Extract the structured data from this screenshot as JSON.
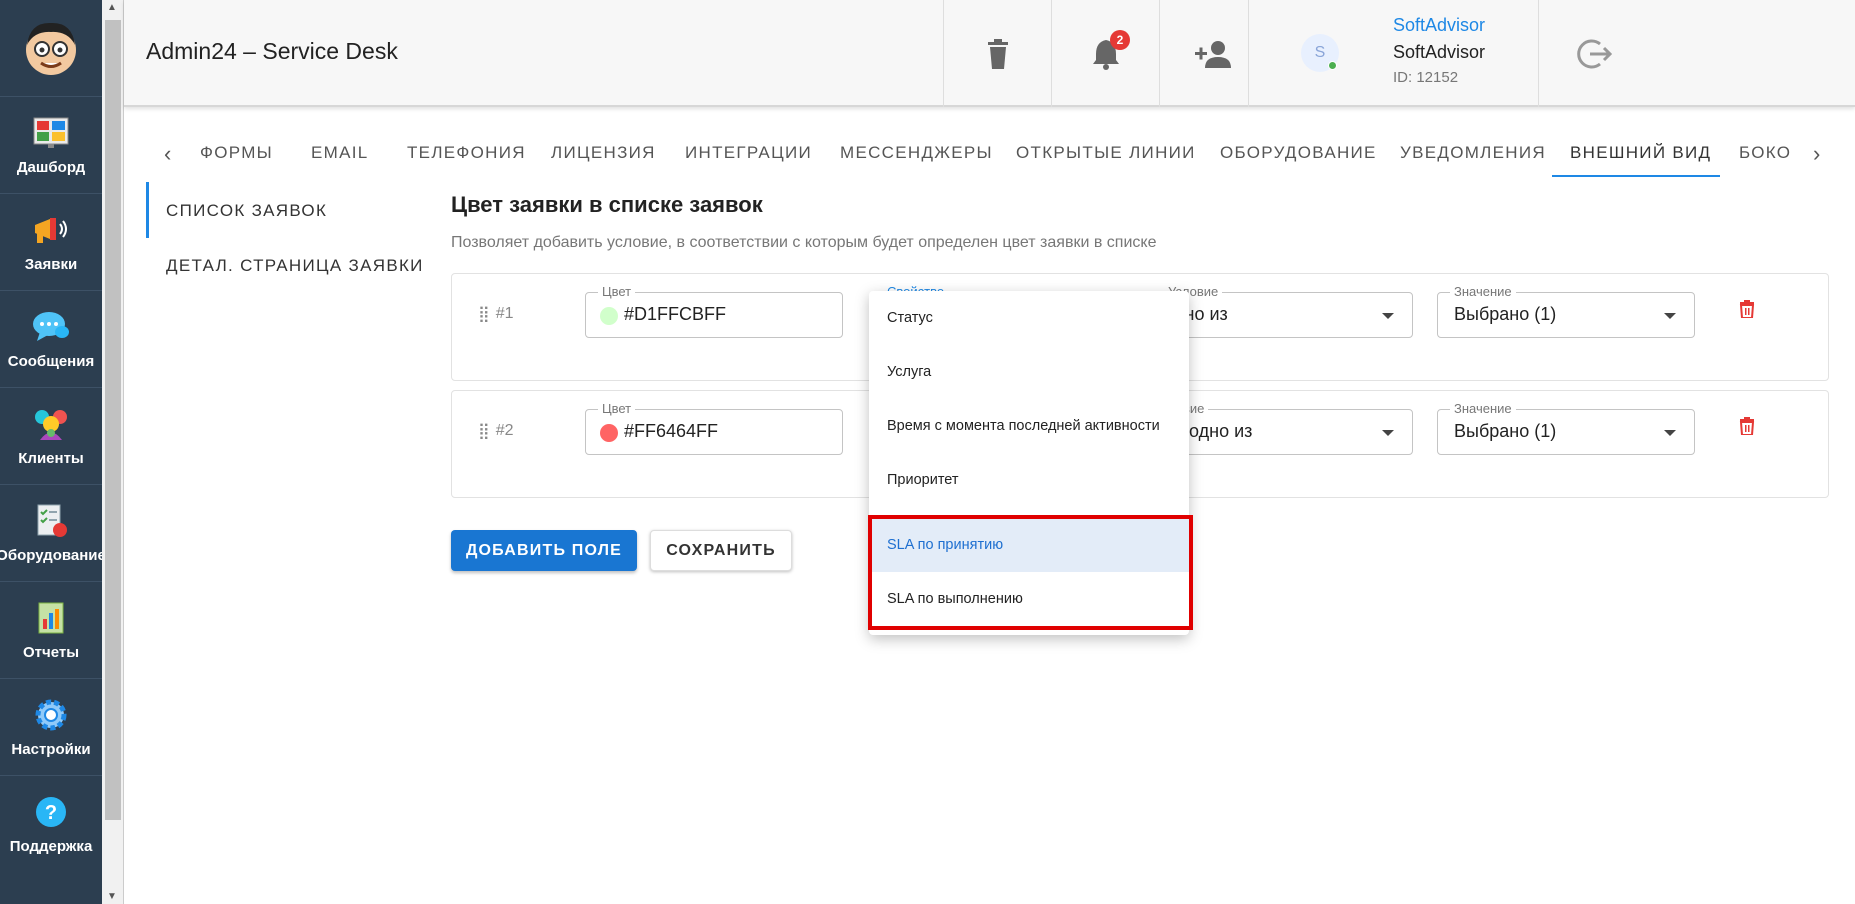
{
  "sidebar": {
    "items": [
      {
        "label": "Дашборд",
        "icon": "dashboard-icon"
      },
      {
        "label": "Заявки",
        "icon": "megaphone-icon"
      },
      {
        "label": "Сообщения",
        "icon": "chat-icon"
      },
      {
        "label": "Клиенты",
        "icon": "clients-icon"
      },
      {
        "label": "Оборудование",
        "icon": "equipment-icon"
      },
      {
        "label": "Отчеты",
        "icon": "reports-icon"
      },
      {
        "label": "Настройки",
        "icon": "gear-icon"
      },
      {
        "label": "Поддержка",
        "icon": "help-icon"
      }
    ]
  },
  "header": {
    "title": "Admin24 – Service Desk",
    "notifications_count": "2",
    "user": {
      "link": "SoftAdvisor",
      "name": "SoftAdvisor",
      "id": "ID: 12152",
      "initial": "S"
    }
  },
  "tabs": {
    "items": [
      "ФОРМЫ",
      "EMAIL",
      "ТЕЛЕФОНИЯ",
      "ЛИЦЕНЗИЯ",
      "ИНТЕГРАЦИИ",
      "МЕССЕНДЖЕРЫ",
      "ОТКРЫТЫЕ ЛИНИИ",
      "ОБОРУДОВАНИЕ",
      "УВЕДОМЛЕНИЯ",
      "ВНЕШНИЙ ВИД",
      "БОКО"
    ],
    "active": "ВНЕШНИЙ ВИД"
  },
  "subnav": {
    "items": [
      "СПИСОК ЗАЯВОК",
      "ДЕТАЛ. СТРАНИЦА ЗАЯВКИ"
    ]
  },
  "main": {
    "title": "Цвет заявки в списке заявок",
    "description": "Позволяет добавить условие, в соответствии с которым будет определен цвет заявки в списке",
    "rules": [
      {
        "num": "#1",
        "color_label": "Цвет",
        "color_value": "#D1FFCBFF",
        "color_hex": "#D1FFCB",
        "condition_label": "Условие",
        "condition_value": "дно из",
        "value_label": "Значение",
        "value_value": "Выбрано (1)"
      },
      {
        "num": "#2",
        "color_label": "Цвет",
        "color_value": "#FF6464FF",
        "color_hex": "#FF6464",
        "condition_label": "ловие",
        "condition_value": "и одно из",
        "value_label": "Значение",
        "value_value": "Выбрано (1)"
      }
    ],
    "property_label": "Свойство",
    "add_button": "ДОБАВИТЬ ПОЛЕ",
    "save_button": "СОХРАНИТЬ"
  },
  "dropdown": {
    "options": [
      "Статус",
      "Услуга",
      "Время с момента последней активности",
      "Приоритет",
      "SLA по принятию",
      "SLA по выполнению"
    ],
    "selected": "SLA по принятию"
  },
  "colors": {
    "accent": "#1976d2",
    "sidebar": "#2c3e50",
    "danger": "#e53935"
  }
}
